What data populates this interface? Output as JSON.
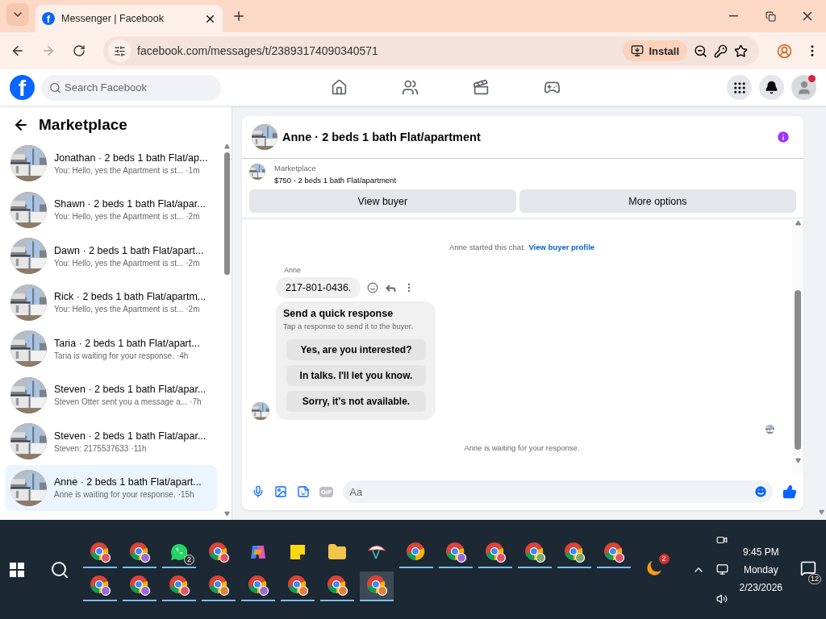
{
  "browser": {
    "tab": {
      "favicon": "f",
      "title": "Messenger | Facebook"
    },
    "url": "facebook.com/messages/t/23893174090340571",
    "install_label": "Install"
  },
  "facebook": {
    "logo": "f",
    "search": {
      "placeholder": "Search Facebook"
    },
    "profile_alert": true
  },
  "sidebar": {
    "title": "Marketplace",
    "conversations": [
      {
        "title": "Jonathan · 2 beds 1 bath Flat/ap...",
        "preview": "You: Hello, yes the Apartment is st...",
        "time": "·1m",
        "selected": false
      },
      {
        "title": "Shawn · 2 beds 1 bath Flat/apar...",
        "preview": "You: Hello, yes the Apartment is st...",
        "time": "·2m",
        "selected": false
      },
      {
        "title": "Dawn · 2 beds 1 bath Flat/apart...",
        "preview": "You: Hello, yes the Apartment is st...",
        "time": "·2m",
        "selected": false
      },
      {
        "title": "Rick · 2 beds 1 bath Flat/apartm...",
        "preview": "You: Hello, yes the Apartment is st...",
        "time": "·2m",
        "selected": false
      },
      {
        "title": "Taria · 2 beds 1 bath Flat/apart...",
        "preview": "Taria is waiting for your response.",
        "time": "·4h",
        "selected": false
      },
      {
        "title": "Steven · 2 beds 1 bath Flat/apar...",
        "preview": "Steven Otter sent you a message a...",
        "time": "·7h",
        "selected": false
      },
      {
        "title": "Steven · 2 beds 1 bath Flat/apar...",
        "preview": "Steven: 2175537633",
        "time": "·11h",
        "selected": false
      },
      {
        "title": "Anne · 2 beds 1 bath Flat/apart...",
        "preview": "Anne is waiting for your response.",
        "time": "·15h",
        "selected": true
      }
    ]
  },
  "chat": {
    "title": "Anne · 2 beds 1 bath Flat/apartment",
    "listing": {
      "label": "Marketplace",
      "name": "$750 - 2 beds 1 bath Flat/apartment"
    },
    "buttons": [
      "View buyer",
      "More options"
    ],
    "system_message": "Anne started this chat.",
    "profile_link": "View buyer profile",
    "sender": "Anne",
    "message": "217-801-0436.",
    "quick_response": {
      "title": "Send a quick response",
      "subtitle": "Tap a response to send it to the buyer.",
      "options": [
        "Yes, are you interested?",
        "In talks. I'll let you know.",
        "Sorry, it's not available."
      ]
    },
    "footer": "Anne is waiting for your response.",
    "composer": {
      "gif_label": "GIF",
      "placeholder": "Aa"
    }
  },
  "taskbar": {
    "rows": [
      [
        {
          "kind": "chrome",
          "color": "#e0536a",
          "running": true,
          "selected": false
        },
        {
          "kind": "chrome",
          "color": "#9b6ad6",
          "running": true,
          "selected": false
        },
        {
          "kind": "whatsapp",
          "badge": "2",
          "running": true,
          "selected": false
        },
        {
          "kind": "chrome",
          "color": "#e0536a",
          "running": false,
          "selected": false
        },
        {
          "kind": "copilot",
          "running": false,
          "selected": false
        },
        {
          "kind": "notes",
          "running": false,
          "selected": false
        },
        {
          "kind": "explorer",
          "running": false,
          "selected": false
        },
        {
          "kind": "snip",
          "running": false,
          "selected": false
        },
        {
          "kind": "chrome",
          "running": true,
          "selected": false
        },
        {
          "kind": "chrome",
          "color": "#9b6ad6",
          "running": true,
          "selected": false
        },
        {
          "kind": "chrome",
          "color": "#e0536a",
          "running": true,
          "selected": false
        },
        {
          "kind": "chrome",
          "color": "#7ea86e",
          "running": true,
          "selected": false
        },
        {
          "kind": "chrome",
          "color": "#7ea86e",
          "running": true,
          "selected": false
        },
        {
          "kind": "chrome",
          "color": "#e0536a",
          "running": true,
          "selected": false
        }
      ],
      [
        {
          "kind": "chrome",
          "color": "#9b6ad6",
          "running": true,
          "selected": false
        },
        {
          "kind": "chrome",
          "color": "#9b6ad6",
          "running": true,
          "selected": false
        },
        {
          "kind": "chrome",
          "color": "#e0536a",
          "running": true,
          "selected": false
        },
        {
          "kind": "chrome",
          "color": "#e0813a",
          "running": true,
          "selected": false
        },
        {
          "kind": "chrome",
          "color": "#9b6ad6",
          "running": true,
          "selected": false
        },
        {
          "kind": "chrome",
          "color": "#e0813a",
          "running": true,
          "selected": false
        },
        {
          "kind": "chrome",
          "color": "#e0813a",
          "running": true,
          "selected": false
        },
        {
          "kind": "chrome",
          "color": "#e0813a",
          "running": true,
          "selected": true
        }
      ]
    ],
    "weather_badge": "2",
    "time": "9:45 PM",
    "day": "Monday",
    "date": "2/23/2026",
    "notifications": "12"
  }
}
